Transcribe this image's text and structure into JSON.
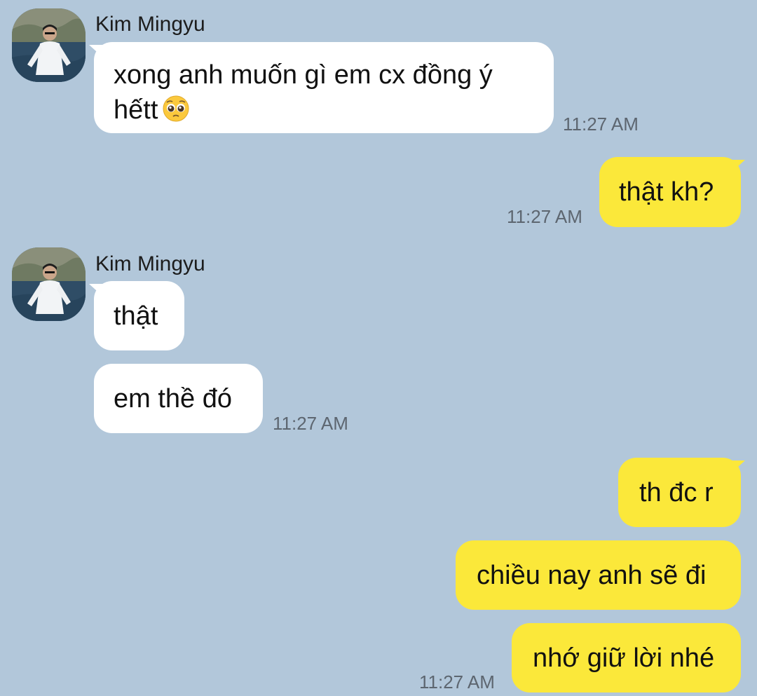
{
  "messages": [
    {
      "sender": "Kim Mingyu",
      "text": "xong anh muốn gì em cx đồng ý",
      "text_line2": "hếtt",
      "emoji": "pleading-face-icon",
      "time": "11:27 AM"
    },
    {
      "sender": "me",
      "text": "thật kh?",
      "time": "11:27 AM"
    },
    {
      "sender": "Kim Mingyu",
      "text": "thật"
    },
    {
      "sender": "Kim Mingyu",
      "text": "em thề đó",
      "time": "11:27 AM"
    },
    {
      "sender": "me",
      "text": "th đc r"
    },
    {
      "sender": "me",
      "text": "chiều nay anh sẽ đi"
    },
    {
      "sender": "me",
      "text": "nhớ giữ lời nhé",
      "time": "11:27 AM"
    }
  ],
  "contact": {
    "name": "Kim Mingyu",
    "avatar": "profile-photo"
  },
  "colors": {
    "background": "#b2c7da",
    "incoming_bubble": "#ffffff",
    "outgoing_bubble": "#fbe83a",
    "timestamp": "#5d6670"
  }
}
